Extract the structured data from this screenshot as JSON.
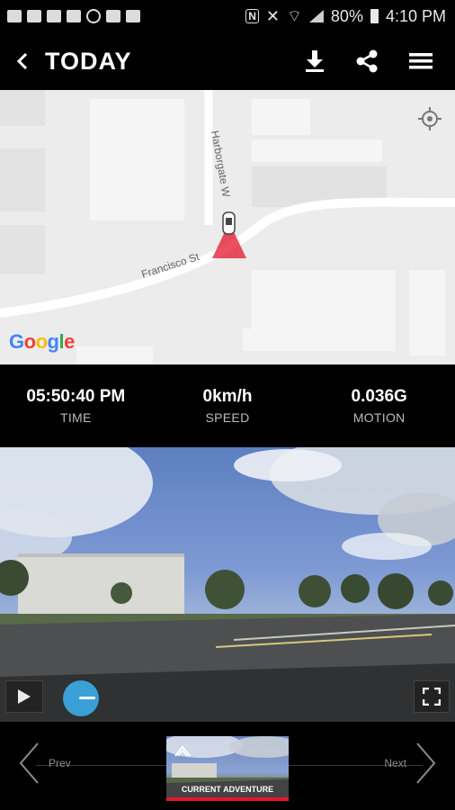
{
  "status_bar": {
    "battery_percent": "80%",
    "time": "4:10 PM"
  },
  "header": {
    "title": "TODAY",
    "icons": [
      "back-chevron-icon",
      "download-icon",
      "share-icon",
      "menu-icon"
    ]
  },
  "map": {
    "attribution": "Google",
    "streets": [
      "Harborgate W",
      "Francisco St"
    ],
    "colors": {
      "road": "#ffffff",
      "background": "#ececec",
      "car_marker": "#e5162b"
    }
  },
  "stats": [
    {
      "value": "05:50:40 PM",
      "label": "TIME"
    },
    {
      "value": "0km/h",
      "label": "SPEED"
    },
    {
      "value": "0.036G",
      "label": "MOTION"
    }
  ],
  "video": {
    "progress_fraction": 0.04,
    "controls": [
      "play-icon",
      "fullscreen-icon"
    ],
    "scrub_color": "#3aa0d6"
  },
  "bottom_nav": {
    "prev_label": "Prev",
    "next_label": "Next",
    "current_label": "CURRENT ADVENTURE",
    "accent": "#e5162b"
  }
}
